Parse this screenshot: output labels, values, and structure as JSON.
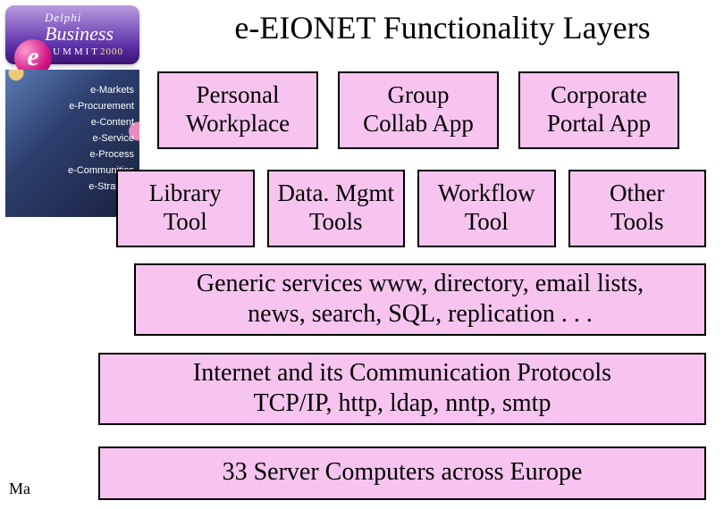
{
  "title": "e-EIONET Functionality Layers",
  "logo": {
    "e": "e",
    "delphi": "Delphi",
    "business": "Business",
    "summit": "SUMMIT",
    "year": "2000"
  },
  "topics": {
    "t1": "e-Markets",
    "t2": "e-Procurement",
    "t3": "e-Content",
    "t4": "e-Service",
    "t5": "e-Process",
    "t6": "e-Communities",
    "t7": "e-Strategy"
  },
  "row1": {
    "b1": {
      "l1": "Personal",
      "l2": "Workplace"
    },
    "b2": {
      "l1": "Group",
      "l2": "Collab App"
    },
    "b3": {
      "l1": "Corporate",
      "l2": "Portal App"
    }
  },
  "row2": {
    "b1": {
      "l1": "Library",
      "l2": "Tool"
    },
    "b2": {
      "l1": "Data. Mgmt",
      "l2": "Tools"
    },
    "b3": {
      "l1": "Workflow",
      "l2": "Tool"
    },
    "b4": {
      "l1": "Other",
      "l2": "Tools"
    }
  },
  "long": {
    "b1": {
      "l1": "Generic services www, directory, email lists,",
      "l2": "news, search, SQL, replication . . ."
    },
    "b2": {
      "l1": "Internet and its Communication Protocols",
      "l2": "TCP/IP, http, ldap, nntp, smtp"
    },
    "b3": {
      "l1": "33 Server Computers across Europe"
    }
  },
  "footer": {
    "ma": "Ma"
  }
}
